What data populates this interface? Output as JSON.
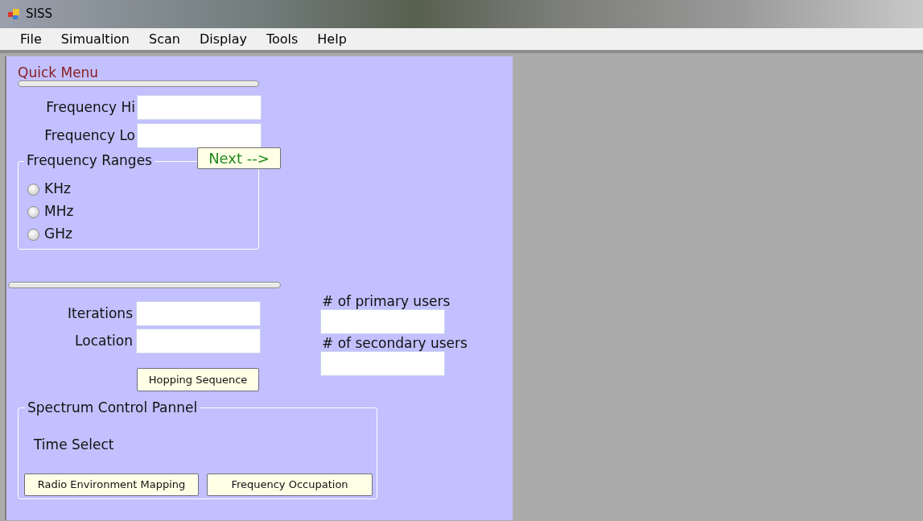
{
  "window": {
    "title": "SISS"
  },
  "menu": [
    "File",
    "Simualtion",
    "Scan",
    "Display",
    "Tools",
    "Help"
  ],
  "quick_menu": {
    "title": "Quick Menu",
    "fields": [
      {
        "label": "Frequency Hi"
      },
      {
        "label": "Frequency Lo"
      }
    ],
    "next_button": "Next -->",
    "frequency_ranges": {
      "title": "Frequency Ranges",
      "options": [
        {
          "label": "KHz",
          "selected": false
        },
        {
          "label": "MHz",
          "selected": false
        },
        {
          "label": "GHz",
          "selected": false
        }
      ]
    }
  },
  "simulation": {
    "fields": [
      {
        "label": "Iterations"
      },
      {
        "label": "Location"
      }
    ],
    "hopping_button": "Hopping Sequence",
    "user_fields": [
      {
        "label": "# of primary users"
      },
      {
        "label": "# of secondary users"
      }
    ]
  },
  "spectrum_panel": {
    "title": "Spectrum Control Pannel",
    "time_label": "Time Select",
    "buttons": [
      "Radio Environment Mapping",
      "Frequency Occupation"
    ]
  }
}
